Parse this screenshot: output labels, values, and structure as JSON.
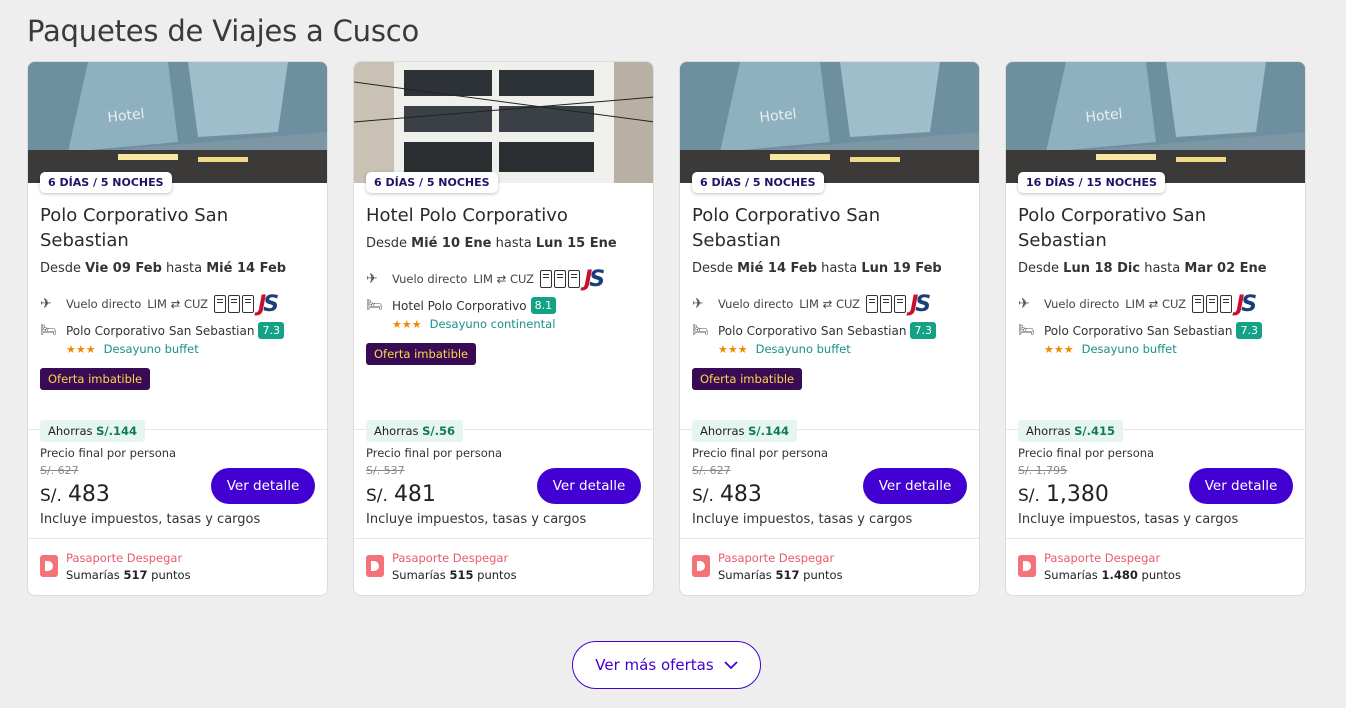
{
  "title": "Paquetes de Viajes a Cusco",
  "packages": [
    {
      "duration": "6 DÍAS / 5 NOCHES",
      "hotel_name": "Polo Corporativo San Sebastian",
      "dates_prefix": "Desde",
      "date_from": "Vie 09 Feb",
      "dates_mid": "hasta",
      "date_to": "Mié 14 Feb",
      "flight_label": "Vuelo directo",
      "origin": "LIM",
      "destination": "CUZ",
      "airline": "JetSMART",
      "hotel_label": "Polo Corporativo San Sebastian",
      "score": "7.3",
      "stars": "★★★",
      "meal": "Desayuno buffet",
      "offer": "Oferta imbatible",
      "savings_label": "Ahorras",
      "savings_amount": "S/.144",
      "final_label": "Precio final por persona",
      "old_price": "S/. 627",
      "currency": "S/.",
      "price": "483",
      "taxes": "Incluye impuestos, tasas y cargos",
      "button": "Ver detalle",
      "passport_title": "Pasaporte Despegar",
      "points_prefix": "Sumarías",
      "points": "517",
      "points_suffix": "puntos"
    },
    {
      "duration": "6 DÍAS / 5 NOCHES",
      "hotel_name": "Hotel Polo Corporativo",
      "dates_prefix": "Desde",
      "date_from": "Mié 10 Ene",
      "dates_mid": "hasta",
      "date_to": "Lun 15 Ene",
      "flight_label": "Vuelo directo",
      "origin": "LIM",
      "destination": "CUZ",
      "airline": "JetSMART",
      "hotel_label": "Hotel Polo Corporativo",
      "score": "8.1",
      "stars": "★★★",
      "meal": "Desayuno continental",
      "offer": "Oferta imbatible",
      "savings_label": "Ahorras",
      "savings_amount": "S/.56",
      "final_label": "Precio final por persona",
      "old_price": "S/. 537",
      "currency": "S/.",
      "price": "481",
      "taxes": "Incluye impuestos, tasas y cargos",
      "button": "Ver detalle",
      "passport_title": "Pasaporte Despegar",
      "points_prefix": "Sumarías",
      "points": "515",
      "points_suffix": "puntos"
    },
    {
      "duration": "6 DÍAS / 5 NOCHES",
      "hotel_name": "Polo Corporativo San Sebastian",
      "dates_prefix": "Desde",
      "date_from": "Mié 14 Feb",
      "dates_mid": "hasta",
      "date_to": "Lun 19 Feb",
      "flight_label": "Vuelo directo",
      "origin": "LIM",
      "destination": "CUZ",
      "airline": "JetSMART",
      "hotel_label": "Polo Corporativo San Sebastian",
      "score": "7.3",
      "stars": "★★★",
      "meal": "Desayuno buffet",
      "offer": "Oferta imbatible",
      "savings_label": "Ahorras",
      "savings_amount": "S/.144",
      "final_label": "Precio final por persona",
      "old_price": "S/. 627",
      "currency": "S/.",
      "price": "483",
      "taxes": "Incluye impuestos, tasas y cargos",
      "button": "Ver detalle",
      "passport_title": "Pasaporte Despegar",
      "points_prefix": "Sumarías",
      "points": "517",
      "points_suffix": "puntos"
    },
    {
      "duration": "16 DÍAS / 15 NOCHES",
      "hotel_name": "Polo Corporativo San Sebastian",
      "dates_prefix": "Desde",
      "date_from": "Lun 18 Dic",
      "dates_mid": "hasta",
      "date_to": "Mar 02 Ene",
      "flight_label": "Vuelo directo",
      "origin": "LIM",
      "destination": "CUZ",
      "airline": "JetSMART",
      "hotel_label": "Polo Corporativo San Sebastian",
      "score": "7.3",
      "stars": "★★★",
      "meal": "Desayuno buffet",
      "offer": "",
      "savings_label": "Ahorras",
      "savings_amount": "S/.415",
      "final_label": "Precio final por persona",
      "old_price": "S/. 1,795",
      "currency": "S/.",
      "price": "1,380",
      "taxes": "Incluye impuestos, tasas y cargos",
      "button": "Ver detalle",
      "passport_title": "Pasaporte Despegar",
      "points_prefix": "Sumarías",
      "points": "1.480",
      "points_suffix": "puntos"
    }
  ],
  "more_button": "Ver más ofertas",
  "colors": {
    "primary": "#4300d2",
    "offer_bg": "#3a0b55",
    "offer_text": "#ffd54a",
    "score_bg": "#14a287",
    "savings_bg": "#e6f6ee",
    "passport": "#e85b6a"
  }
}
